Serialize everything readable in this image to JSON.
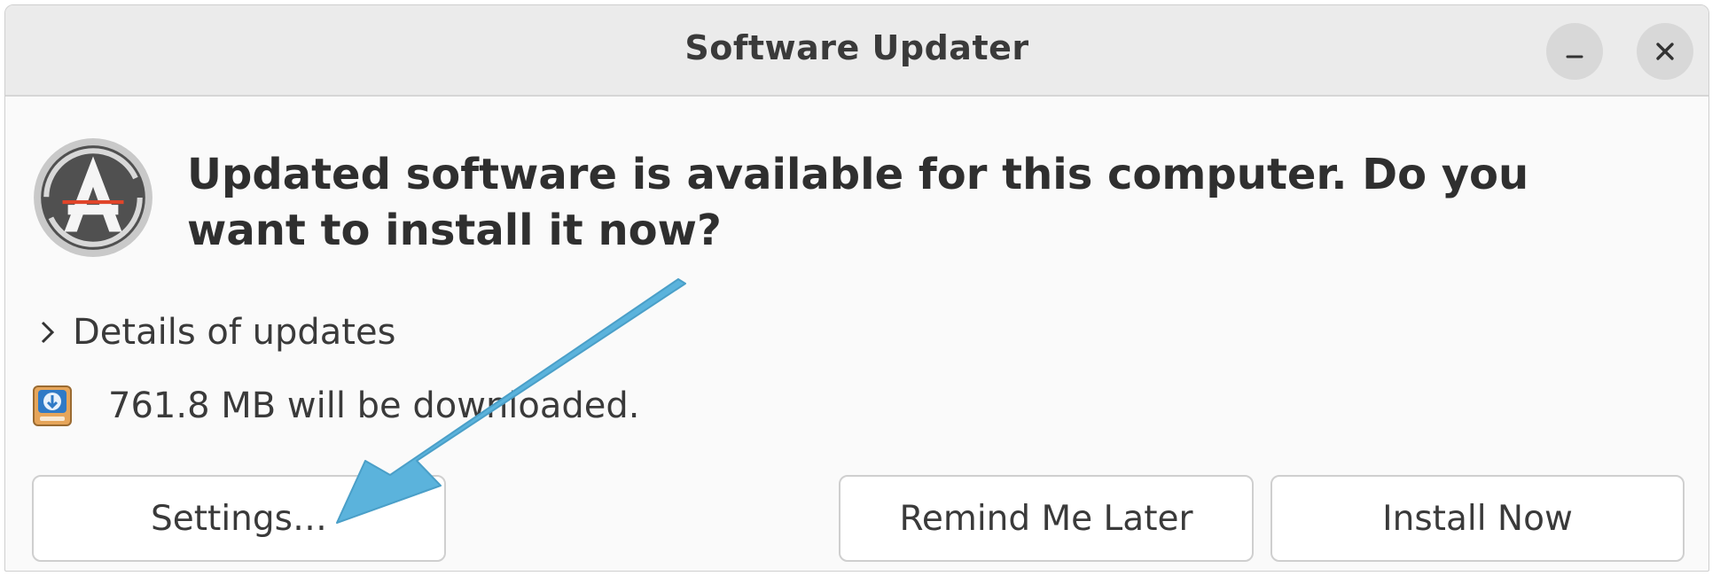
{
  "window": {
    "title": "Software Updater",
    "minimize_icon": "minimize-icon",
    "close_icon": "close-icon"
  },
  "app_icon": "software-updater-icon",
  "headline": "Updated software is available for this computer. Do you want to install it now?",
  "details": {
    "icon": "chevron-right-icon",
    "label": "Details of updates"
  },
  "download": {
    "icon": "download-drive-icon",
    "text": "761.8 MB will be downloaded."
  },
  "buttons": {
    "settings": "Settings…",
    "remind": "Remind Me Later",
    "install": "Install Now"
  },
  "annotation": {
    "icon": "pointer-arrow-icon",
    "color": "#5bb3dc",
    "target": "Settings…"
  },
  "colors": {
    "titlebar": "#ebebeb",
    "dialog_bg": "#fafafa",
    "text": "#3a3a3a",
    "icon_accent": "#e0452a"
  }
}
